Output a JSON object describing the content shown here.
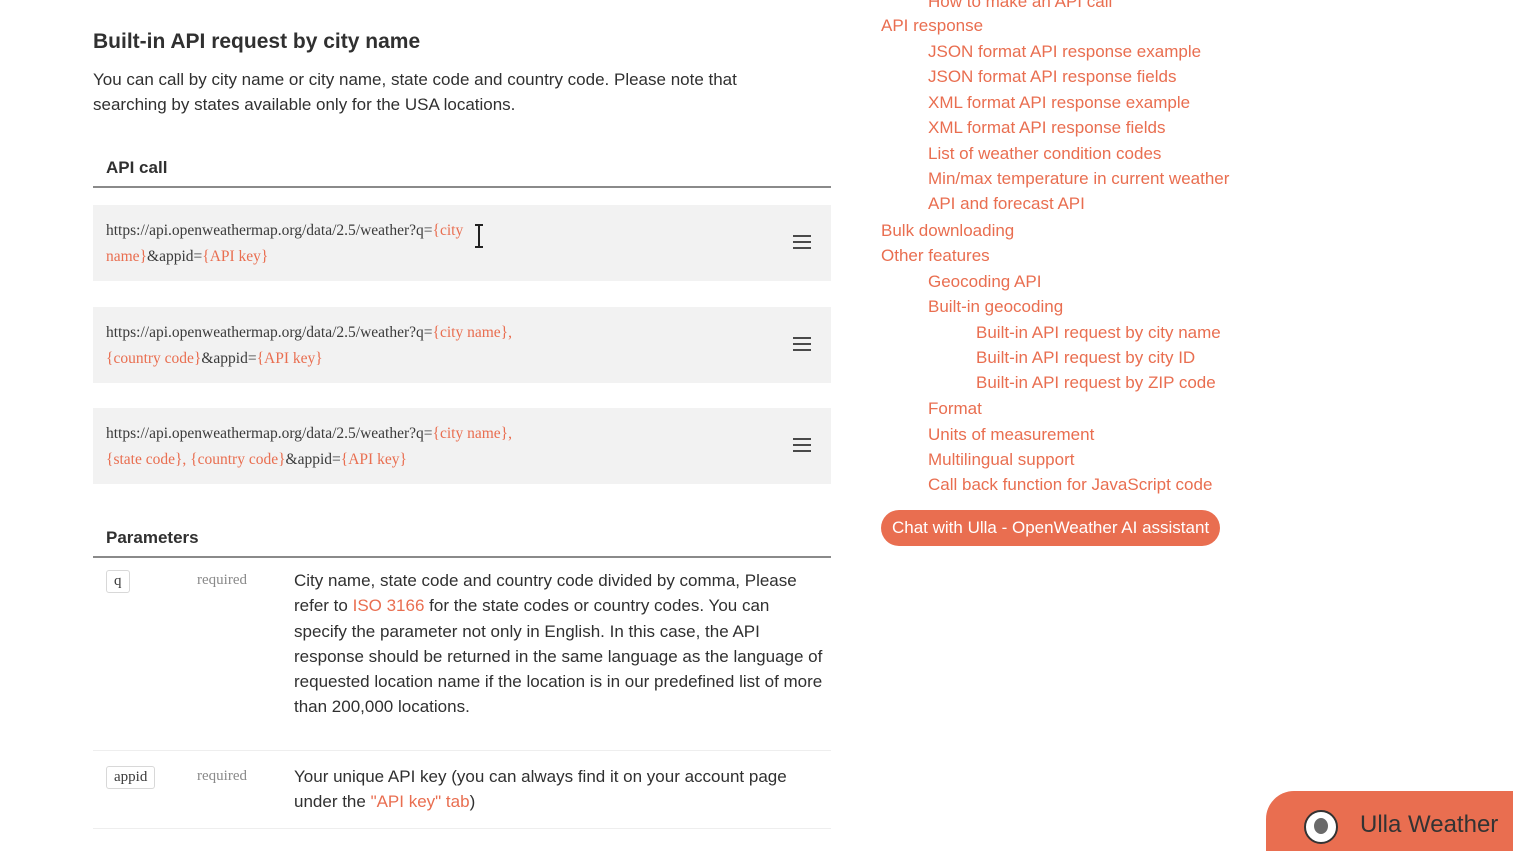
{
  "section": {
    "title": "Built-in API request by city name",
    "intro": "You can call by city name or city name, state code and country code. Please note that searching by states available only for the USA locations."
  },
  "api_call": {
    "header": "API call",
    "examples": [
      {
        "prefix": "https://api.openweathermap.org/data/2.5/weather?q=",
        "p1": "{city\nname}",
        "mid1": "&appid=",
        "p2": "{API key}",
        "mid2": "",
        "p3": ""
      },
      {
        "prefix": "https://api.openweathermap.org/data/2.5/weather?q=",
        "p1": "{city name},\n{country code}",
        "mid1": "&appid=",
        "p2": "{API key}",
        "mid2": "",
        "p3": ""
      },
      {
        "prefix": "https://api.openweathermap.org/data/2.5/weather?q=",
        "p1": "{city name},\n{state code},",
        "mid1": " ",
        "p2": "{country code}",
        "mid2": "&appid=",
        "p3": "{API key}"
      }
    ]
  },
  "parameters": {
    "header": "Parameters",
    "rows": [
      {
        "name": "q",
        "requirement": "required",
        "desc_before": "City name, state code and country code divided by comma, Please refer to ",
        "link": "ISO 3166",
        "desc_after": " for the state codes or country codes. You can specify the parameter not only in English. In this case, the API response should be returned in the same language as the language of requested location name if the location is in our predefined list of more than 200,000 locations."
      },
      {
        "name": "appid",
        "requirement": "required",
        "desc_before": "Your unique API key (you can always find it on your account page under the ",
        "link": "\"API key\" tab",
        "desc_after": ")"
      }
    ]
  },
  "toc": {
    "items": [
      {
        "label": "How to make an API call",
        "level": 1
      },
      {
        "label": "API response",
        "level": 0
      },
      {
        "label": "JSON format API response example",
        "level": 1
      },
      {
        "label": "JSON format API response fields",
        "level": 1
      },
      {
        "label": "XML format API response example",
        "level": 1
      },
      {
        "label": "XML format API response fields",
        "level": 1
      },
      {
        "label": "List of weather condition codes",
        "level": 1
      },
      {
        "label": "Min/max temperature in current weather",
        "level": 1
      },
      {
        "label": "API and forecast API",
        "level": 1
      },
      {
        "label": "Bulk downloading",
        "level": 0
      },
      {
        "label": "Other features",
        "level": 0
      },
      {
        "label": "Geocoding API",
        "level": 1
      },
      {
        "label": "Built-in geocoding",
        "level": 1
      },
      {
        "label": "Built-in API request by city name",
        "level": 2
      },
      {
        "label": "Built-in API request by city ID",
        "level": 2
      },
      {
        "label": "Built-in API request by ZIP code",
        "level": 2
      },
      {
        "label": "Format",
        "level": 1
      },
      {
        "label": "Units of measurement",
        "level": 1
      },
      {
        "label": "Multilingual support",
        "level": 1
      },
      {
        "label": "Call back function for JavaScript code",
        "level": 1
      }
    ],
    "chat_button": "Chat with Ulla - OpenWeather AI assistant"
  },
  "widget": {
    "label": "Ulla Weather"
  },
  "colors": {
    "accent": "#e96e50",
    "code_bg": "#f2f2f2",
    "text": "#303030"
  },
  "icons": [
    "copy-icon",
    "text-cursor-icon",
    "assistant-avatar-icon"
  ]
}
